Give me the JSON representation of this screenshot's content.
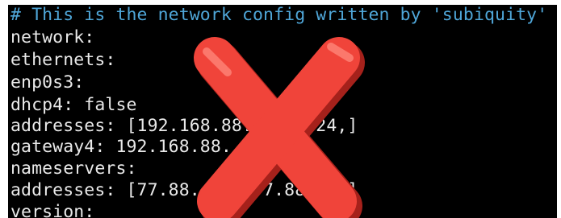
{
  "terminal": {
    "lines": [
      "# This is the network config written by 'subiquity'",
      "network:",
      "ethernets:",
      "enp0s3:",
      "dhcp4: false",
      "addresses: [192.168.88.  .  /24,]",
      "gateway4: 192.168.88.",
      "nameservers:",
      "addresses: [77.88. .8, 77.88. .1]",
      "version:"
    ]
  },
  "overlay": {
    "icon": "red-x-icon",
    "fill_color": "#f0443a",
    "highlight_color": "#ff8a7e",
    "shadow_color": "#a5211b"
  }
}
